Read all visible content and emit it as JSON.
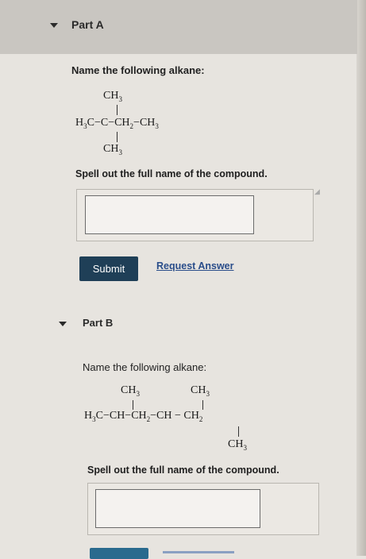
{
  "partA": {
    "title": "Part A",
    "prompt": "Name the following alkane:",
    "structure": {
      "top": "CH3",
      "main": "H3C−C−CH2−CH3",
      "bottom": "CH3"
    },
    "spell": "Spell out the full name of the compound.",
    "answer_value": "",
    "submit_label": "Submit",
    "request_label": "Request Answer"
  },
  "partB": {
    "title": "Part B",
    "prompt": "Name the following alkane:",
    "structure": {
      "top_left": "CH3",
      "top_right": "CH3",
      "main": "H3C−CH−CH2−CH − CH2",
      "bottom": "CH3"
    },
    "spell": "Spell out the full name of the compound.",
    "answer_value": ""
  },
  "colors": {
    "submit_bg": "#1f3f57",
    "link": "#2a4d8a",
    "header_bg": "#c9c6c1"
  },
  "icons": [
    "caret-down-icon",
    "caret-down-icon"
  ]
}
